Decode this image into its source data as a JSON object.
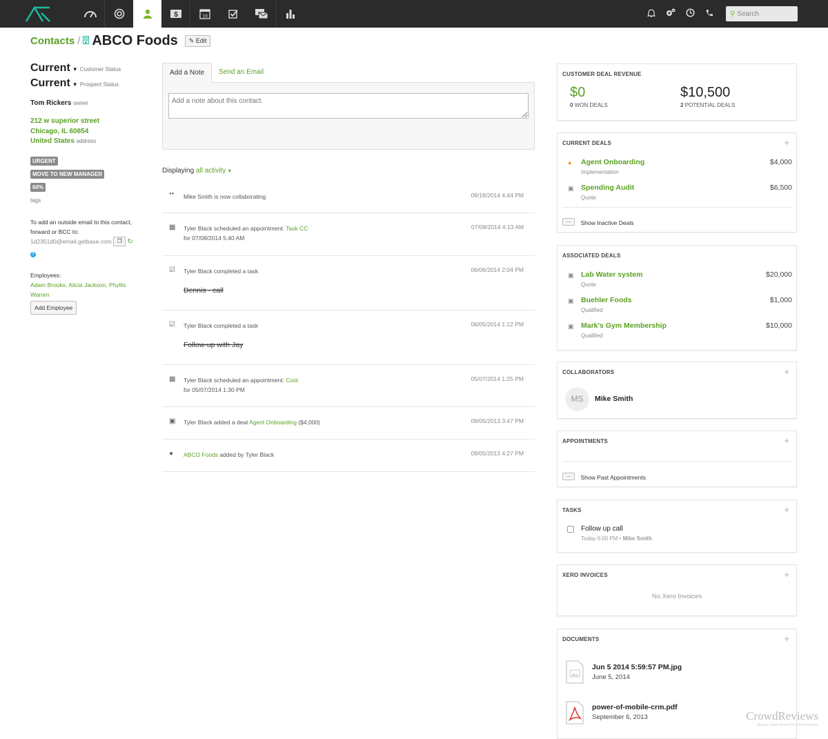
{
  "nav": {
    "icons": [
      "dashboard-icon",
      "power-icon",
      "contacts-icon",
      "deals-icon",
      "calendar-icon",
      "tasks-icon",
      "mail-icon",
      "reports-icon"
    ],
    "calendar_day": "18",
    "search_placeholder": "Search",
    "right_icons": [
      "bell-icon",
      "settings-icon",
      "clock-icon",
      "phone-icon"
    ]
  },
  "header": {
    "breadcrumb": "Contacts",
    "separator": "/",
    "title": "ABCO Foods",
    "edit_label": "Edit"
  },
  "contact": {
    "customer_status": "Current",
    "customer_status_label": "Customer Status",
    "prospect_status": "Current",
    "prospect_status_label": "Prospect Status",
    "owner_name": "Tom Rickers",
    "owner_label": "owner",
    "address_line1": "212 w superior street",
    "address_line2": "Chicago, IL 60654",
    "address_line3": "United States",
    "address_label": "address",
    "tags": [
      "URGENT",
      "MOVE TO NEW MANAGER",
      "60%"
    ],
    "tags_label": "tags",
    "forward_text1": "To add an outside email to this contact,",
    "forward_text2": "forward or BCC to:",
    "forward_email": "1d2351d0@email.getbase.com",
    "employees_label": "Employees:",
    "employees_line1": "Adam Brooks, Alicia Jackson, Phyllis",
    "employees_line2": "Warren",
    "add_employee": "Add Employee"
  },
  "composer": {
    "tab_note": "Add a Note",
    "tab_email": "Send an Email",
    "placeholder": "Add a note about this contact."
  },
  "feed": {
    "displaying": "Displaying",
    "filter": "all activity",
    "items": [
      {
        "pre": "Mike Smith is now collaborating",
        "link": "",
        "post": "",
        "sub": "",
        "strike": "",
        "date": "09/18/2014 4:44 PM"
      },
      {
        "pre": "Tyler Black scheduled an appointment: ",
        "link": "Task CC",
        "post": "",
        "sub": "for 07/08/2014 5:40 AM",
        "strike": "",
        "date": "07/08/2014 4:13 AM"
      },
      {
        "pre": "Tyler Black completed a task",
        "link": "",
        "post": "",
        "sub": "",
        "strike": "Dennis - call",
        "date": "06/06/2014 2:04 PM"
      },
      {
        "pre": "Tyler Black completed a task",
        "link": "",
        "post": "",
        "sub": "",
        "strike": "Follow-up with Jay",
        "date": "06/05/2014 1:12 PM"
      },
      {
        "pre": "Tyler Black scheduled an appointment: ",
        "link": "Cool",
        "post": "",
        "sub": "for 05/07/2014 1:30 PM",
        "strike": "",
        "date": "05/07/2014 1:25 PM"
      },
      {
        "pre": "Tyler Black added a deal ",
        "link": "Agent Onboarding",
        "post": " ($4,000)",
        "sub": "",
        "strike": "",
        "date": "09/05/2013 3:47 PM"
      },
      {
        "pre": "",
        "link": "ABCO Foods",
        "post": " added by Tyler Black",
        "sub": "",
        "strike": "",
        "date": "09/05/2013 4:27 PM"
      }
    ]
  },
  "revenue": {
    "heading": "CUSTOMER DEAL REVENUE",
    "won_value": "$0",
    "won_count": "0",
    "won_label": "WON DEALS",
    "potential_value": "$10,500",
    "potential_count": "2",
    "potential_label": "POTENTIAL DEALS"
  },
  "current_deals": {
    "heading": "CURRENT DEALS",
    "plus": "+",
    "items": [
      {
        "name": "Agent Onboarding",
        "stage": "Implementation",
        "value": "$4,000"
      },
      {
        "name": "Spending Audit",
        "stage": "Quote",
        "value": "$6,500"
      }
    ],
    "show_inactive": "Show Inactive Deals",
    "dots": "..."
  },
  "associated_deals": {
    "heading": "ASSOCIATED DEALS",
    "items": [
      {
        "name": "Lab Water system",
        "stage": "Quote",
        "value": "$20,000"
      },
      {
        "name": "Buehler Foods",
        "stage": "Qualified",
        "value": "$1,000"
      },
      {
        "name": "Mark's Gym Membership",
        "stage": "Qualified",
        "value": "$10,000"
      }
    ]
  },
  "collaborators": {
    "heading": "COLLABORATORS",
    "initials": "MS",
    "name": "Mike Smith"
  },
  "appointments": {
    "heading": "APPOINTMENTS",
    "show_past": "Show Past Appointments"
  },
  "tasks": {
    "heading": "TASKS",
    "task_name": "Follow up call",
    "task_when": "Today 6:00 PM",
    "task_sep": " • ",
    "task_owner": "Mike Smith"
  },
  "xero": {
    "heading": "XERO INVOICES",
    "empty": "No Xero Invoices"
  },
  "documents": {
    "heading": "DOCUMENTS",
    "items": [
      {
        "name": "Jun 5 2014 5:59:57 PM.jpg",
        "date": "June 5, 2014"
      },
      {
        "name": "power-of-mobile-crm.pdf",
        "date": "September 6, 2013"
      }
    ]
  },
  "watermark": {
    "title": "CrowdReviews",
    "sub": "Buyers Guide Based On Client Reviews"
  },
  "colors": {
    "accent": "#5aa122",
    "nav_bg": "#2b2b2b",
    "logo": "#1abc9c"
  }
}
